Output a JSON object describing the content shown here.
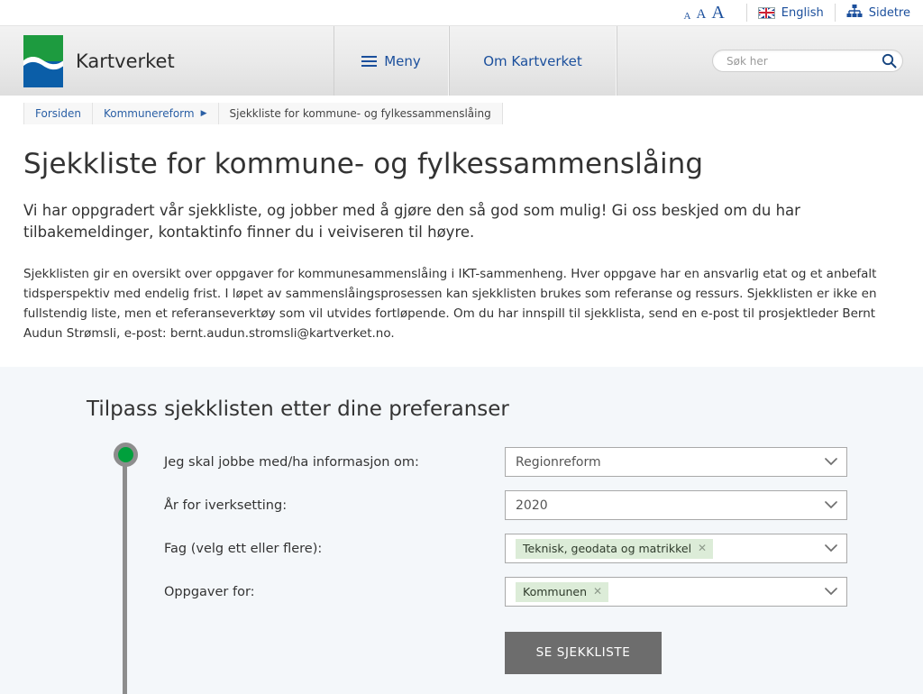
{
  "topbar": {
    "font_sizes": [
      "A",
      "A",
      "A"
    ],
    "language": {
      "label": "English",
      "icon": "uk-flag-icon"
    },
    "sitemap": {
      "label": "Sidetre",
      "icon": "sitemap-icon"
    }
  },
  "header": {
    "brand": "Kartverket",
    "nav": [
      {
        "label": "Meny",
        "icon": "hamburger-icon"
      },
      {
        "label": "Om Kartverket"
      }
    ],
    "search": {
      "placeholder": "Søk her",
      "value": "",
      "icon": "search-icon"
    }
  },
  "breadcrumb": [
    {
      "label": "Forsiden",
      "current": false
    },
    {
      "label": "Kommunereform",
      "current": false
    },
    {
      "label": "Sjekkliste for kommune- og fylkessammenslåing",
      "current": true
    }
  ],
  "article": {
    "title": "Sjekkliste for kommune- og fylkessammenslåing",
    "lead": "Vi har oppgradert vår sjekkliste, og jobber med å gjøre den så god som mulig! Gi oss beskjed om du har tilbakemeldinger, kontaktinfo finner du i veiviseren til høyre.",
    "body": "Sjekklisten gir en oversikt over oppgaver for kommunesammenslåing i IKT-sammenheng. Hver oppgave har en ansvarlig etat og et anbefalt tidsperspektiv med endelig frist. I løpet av sammenslåingsprosessen kan sjekklisten brukes som referanse og ressurs. Sjekklisten er ikke en fullstendig liste, men et referanseverktøy som vil utvides fortløpende. Om du har innspill til sjekklista, send en e-post til prosjektleder Bernt Audun Strømsli, e-post: bernt.audun.stromsli@kartverket.no."
  },
  "preferences": {
    "title": "Tilpass sjekklisten etter dine preferanser",
    "fields": [
      {
        "label": "Jeg skal jobbe med/ha informasjon om:",
        "type": "select",
        "value": "Regionreform"
      },
      {
        "label": "År for iverksetting:",
        "type": "select",
        "value": "2020"
      },
      {
        "label": "Fag (velg ett eller flere):",
        "type": "multiselect",
        "tags": [
          "Teknisk, geodata og matrikkel"
        ]
      },
      {
        "label": "Oppgaver for:",
        "type": "multiselect",
        "tags": [
          "Kommunen"
        ]
      }
    ],
    "submit_label": "SE SJEKKLISTE",
    "tag_remove_glyph": "✕"
  },
  "colors": {
    "brand_green": "#1d9b3f",
    "brand_blue": "#0b5ea8",
    "link_blue": "#1b4f9c",
    "marker_green": "#00a03c",
    "tag_green": "#dcecd8",
    "button_gray": "#6d6d6d",
    "panel_bg": "#f4f7fa"
  }
}
